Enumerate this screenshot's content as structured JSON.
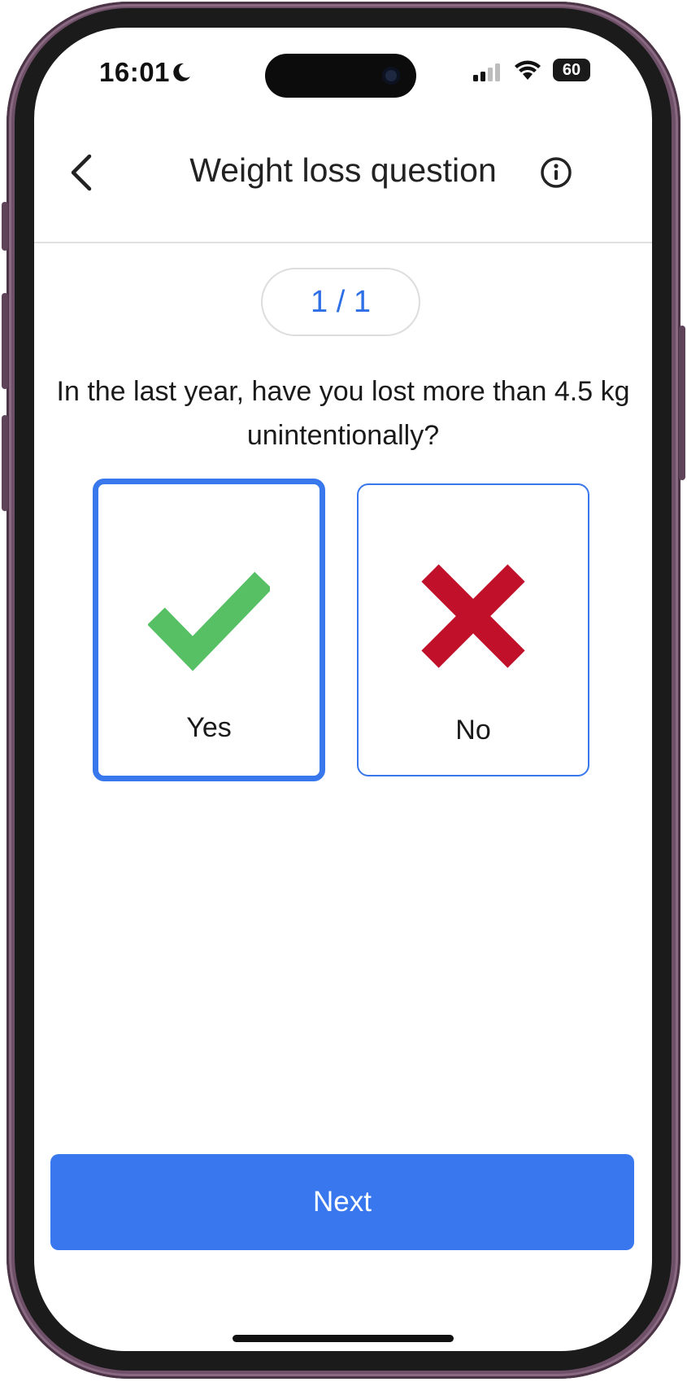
{
  "status_bar": {
    "time": "16:01",
    "battery_level": "60"
  },
  "header": {
    "title": "Weight loss question"
  },
  "progress": {
    "label": "1 / 1",
    "current": 1,
    "total": 1
  },
  "question": {
    "text": "In the last year, have you lost more than 4.5 kg unintentionally?"
  },
  "answers": [
    {
      "label": "Yes",
      "icon": "checkmark-icon",
      "selected": true,
      "icon_color": "#57c064"
    },
    {
      "label": "No",
      "icon": "cross-icon",
      "selected": false,
      "icon_color": "#c0102a"
    }
  ],
  "footer": {
    "next_label": "Next"
  },
  "colors": {
    "accent": "#3877ee",
    "phone_frame": "#6e5068"
  }
}
